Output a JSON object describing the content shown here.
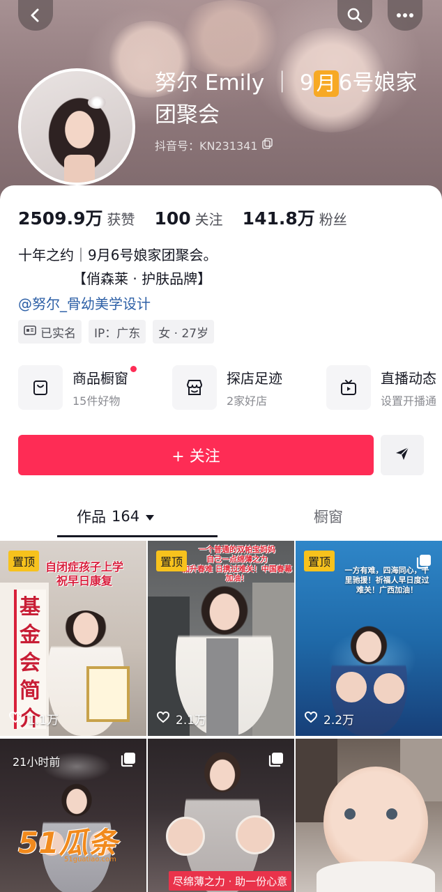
{
  "colors": {
    "accent": "#fe2c55",
    "pinned_badge": "#f7c21d",
    "mention_link": "#2c5fa6",
    "month_highlight": "#f7a924"
  },
  "header": {
    "back_icon": "chevron-left-icon",
    "search_icon": "search-icon",
    "more_icon": "more-dots-icon",
    "name_prefix": "努尔 Emily ｜ 9",
    "name_month": "月",
    "name_suffix": "6号娘家团聚会",
    "douyin_id": "抖音号：KN231341",
    "copy_icon": "copy-icon"
  },
  "stats": [
    {
      "number": "2509.9万",
      "label": "获赞"
    },
    {
      "number": "100",
      "label": "关注"
    },
    {
      "number": "141.8万",
      "label": "粉丝"
    }
  ],
  "bio": {
    "line1": "十年之约｜9月6号娘家团聚会。",
    "line2": "【俏森莱 · 护肤品牌】",
    "mention": "@努尔_骨幼美学设计"
  },
  "tags": [
    {
      "icon": "id-card-icon",
      "label": "已实名"
    },
    {
      "icon": "",
      "label": "IP：广东"
    },
    {
      "icon": "",
      "label": "女 · 27岁"
    }
  ],
  "features": [
    {
      "icon": "shopping-bag-icon",
      "title": "商品橱窗",
      "subtitle": "15件好物",
      "has_dot": true
    },
    {
      "icon": "store-icon",
      "title": "探店足迹",
      "subtitle": "2家好店",
      "has_dot": false
    },
    {
      "icon": "tv-play-icon",
      "title": "直播动态",
      "subtitle": "设置开播通",
      "has_dot": false
    }
  ],
  "actions": {
    "follow_label": "+ 关注",
    "share_icon": "send-arrow-icon"
  },
  "tabs": {
    "works_label": "作品",
    "works_count": "164",
    "shop_label": "橱窗"
  },
  "videos": [
    {
      "badge": "置顶",
      "likes": "1.1万",
      "overlay": "自闭症孩子上学\n祝早日康复",
      "board_text": "基金会简介"
    },
    {
      "badge": "置顶",
      "likes": "2.1万",
      "overlay": "一个普通的双帕宝妈妈\n自己一点绵薄之力\n加升春难  日携过难关！中国春幕加油！"
    },
    {
      "badge": "置顶",
      "likes": "2.2万",
      "overlay": "一方有难，四海同心，千\n里驰援！祈福人早日度过\n难关！广西加油！"
    },
    {
      "time": "21小时前"
    },
    {
      "caption": "尽绵薄之力 · 助一份心意"
    },
    {}
  ],
  "watermark": {
    "main": "51瓜条",
    "sub": "51guatiao.com"
  }
}
